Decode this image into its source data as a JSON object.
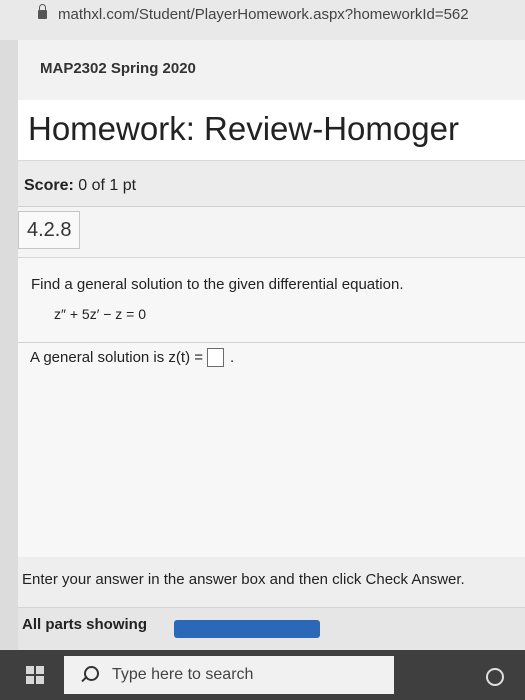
{
  "browser": {
    "url": "mathxl.com/Student/PlayerHomework.aspx?homeworkId=562"
  },
  "course": {
    "name": "MAP2302 Spring 2020"
  },
  "homework": {
    "title": "Homework: Review-Homoger",
    "score_label": "Score:",
    "score_value": "0 of 1 pt",
    "question_number": "4.2.8"
  },
  "question": {
    "prompt": "Find a general solution to the given differential equation.",
    "equation": "z″ + 5z′ − z = 0",
    "answer_prefix": "A general solution is z(t) =",
    "answer_value": "",
    "answer_suffix": "."
  },
  "footer": {
    "instruction": "Enter your answer in the answer box and then click Check Answer.",
    "parts_label": "All parts showing",
    "parts_progress": 1.0
  },
  "taskbar": {
    "search_placeholder": "Type here to search"
  },
  "icons": {
    "lock": "lock-icon",
    "windows": "windows-start-icon",
    "search": "search-icon",
    "cortana": "cortana-icon"
  },
  "colors": {
    "progress_bar": "#2b68b8",
    "taskbar": "#3f3f3f"
  }
}
